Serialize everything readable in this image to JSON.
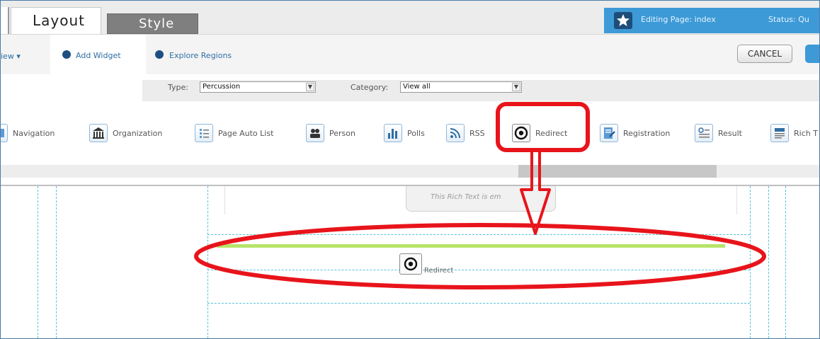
{
  "tabs": {
    "layout": "Layout",
    "style": "Style"
  },
  "header": {
    "editing": "Editing Page: index",
    "status": "Status: Qu"
  },
  "toolbar": {
    "view": "iew ▾",
    "add_widget": "Add Widget",
    "explore_regions": "Explore Regions",
    "cancel": "CANCEL"
  },
  "filters": {
    "type_label": "Type:",
    "type_value": "Percussion",
    "category_label": "Category:",
    "category_value": "View all"
  },
  "widgets": [
    {
      "label": "Navigation",
      "icon": "document-icon"
    },
    {
      "label": "Organization",
      "icon": "building-icon"
    },
    {
      "label": "Page Auto List",
      "icon": "list-icon"
    },
    {
      "label": "Person",
      "icon": "people-icon"
    },
    {
      "label": "Polls",
      "icon": "bar-chart-icon"
    },
    {
      "label": "RSS",
      "icon": "rss-icon"
    },
    {
      "label": "Redirect",
      "icon": "target-icon"
    },
    {
      "label": "Registration",
      "icon": "form-icon"
    },
    {
      "label": "Result",
      "icon": "search-list-icon"
    },
    {
      "label": "Rich T",
      "icon": "rich-text-icon"
    }
  ],
  "canvas": {
    "rich_text_placeholder": "This Rich Text is em",
    "dropped_label": "Redirect"
  },
  "colors": {
    "accent": "#3d9ad7",
    "annotation": "#e8141b",
    "drop_indicator": "#b7e46a",
    "region_border": "#56c2d8"
  }
}
